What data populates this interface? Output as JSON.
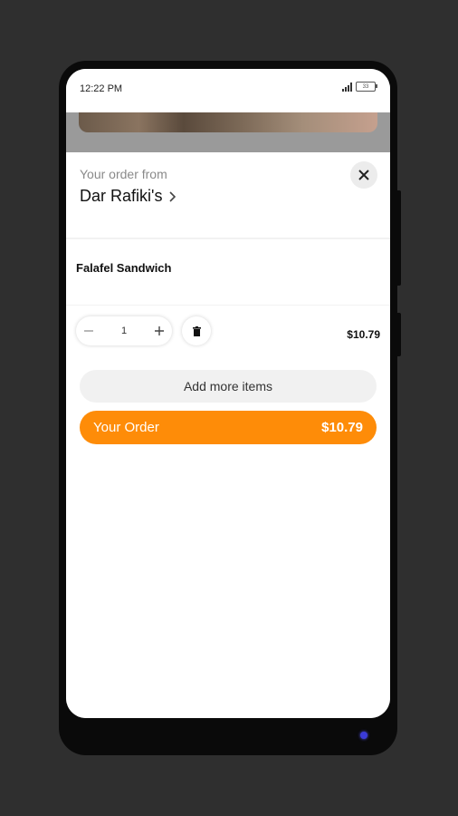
{
  "status_bar": {
    "time": "12:22 PM",
    "battery": "33"
  },
  "order_sheet": {
    "from_label": "Your order from",
    "restaurant_name": "Dar Rafiki's",
    "items": [
      {
        "name": "Falafel Sandwich",
        "quantity": "1",
        "price": "$10.79"
      }
    ],
    "add_more_label": "Add more items",
    "your_order_label": "Your Order",
    "order_total": "$10.79"
  },
  "colors": {
    "accent": "#fe8c08",
    "background": "#2f2f2f",
    "pill_gray": "#f1f1f1"
  },
  "icons": [
    "close-icon",
    "chevron-right-icon",
    "minus-icon",
    "plus-icon",
    "trash-icon",
    "signal-icon",
    "battery-icon"
  ]
}
